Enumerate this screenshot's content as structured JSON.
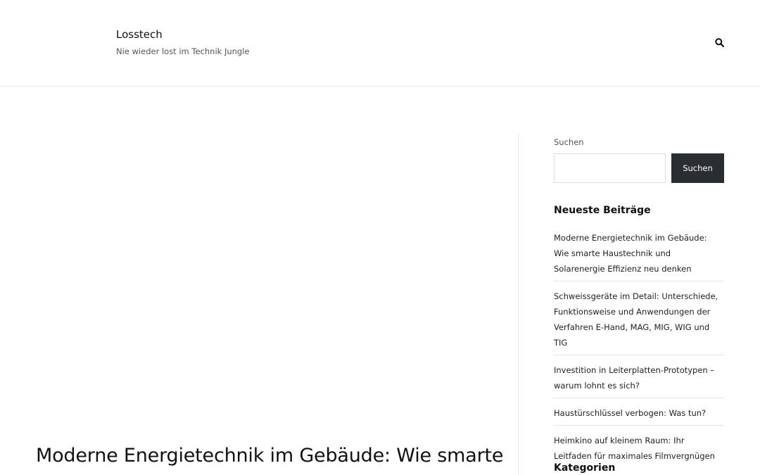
{
  "header": {
    "site_title": "Losstech",
    "tagline": "Nie wieder lost im Technik Jungle",
    "search_icon": "search-icon"
  },
  "main": {
    "post_title": "Moderne Energietechnik im Gebäude: Wie smarte"
  },
  "sidebar": {
    "search": {
      "label": "Suchen",
      "input_value": "",
      "button_label": "Suchen"
    },
    "recent_posts": {
      "title": "Neueste Beiträge",
      "items": [
        "Moderne Energietechnik im Gebäude: Wie smarte Haustechnik und Solarenergie Effizienz neu denken",
        "Schweissgeräte im Detail: Unterschiede, Funktionsweise und Anwendungen der Verfahren E-Hand, MAG, MIG, WIG und TIG",
        "Investition in Leiterplatten-Prototypen – warum lohnt es sich?",
        "Haustürschlüssel verbogen: Was tun?",
        "Heimkino auf kleinem Raum: Ihr Leitfaden für maximales Filmvergnügen"
      ]
    },
    "categories": {
      "title": "Kategorien"
    }
  },
  "colors": {
    "button_bg": "#2a2e33",
    "divider": "#e6e6e6"
  }
}
